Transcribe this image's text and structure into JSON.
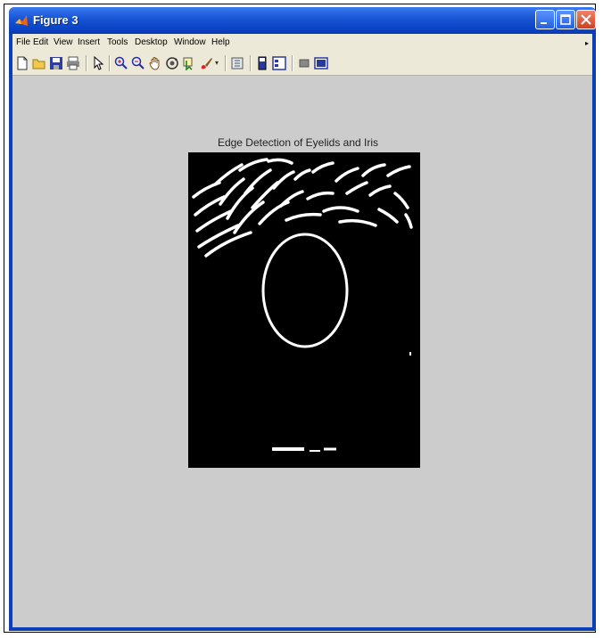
{
  "window": {
    "title": "Figure 3",
    "colors": {
      "titlebar": "#0a44c6",
      "close": "#d0401e",
      "client": "#cccccc"
    }
  },
  "menubar": {
    "items": [
      "File",
      "Edit",
      "View",
      "Insert",
      "Tools",
      "Desktop",
      "Window",
      "Help"
    ]
  },
  "toolbar": {
    "buttons": [
      "new-figure-icon",
      "open-file-icon",
      "save-icon",
      "print-icon",
      "pointer-icon",
      "zoom-in-icon",
      "zoom-out-icon",
      "pan-hand-icon",
      "rotate-3d-icon",
      "data-cursor-icon",
      "brush-icon",
      "link-plot-icon",
      "colorbar-icon",
      "legend-icon",
      "hide-plot-tools-icon",
      "show-plot-tools-icon"
    ]
  },
  "axes": {
    "title": "Edge Detection of Eyelids and Iris"
  }
}
